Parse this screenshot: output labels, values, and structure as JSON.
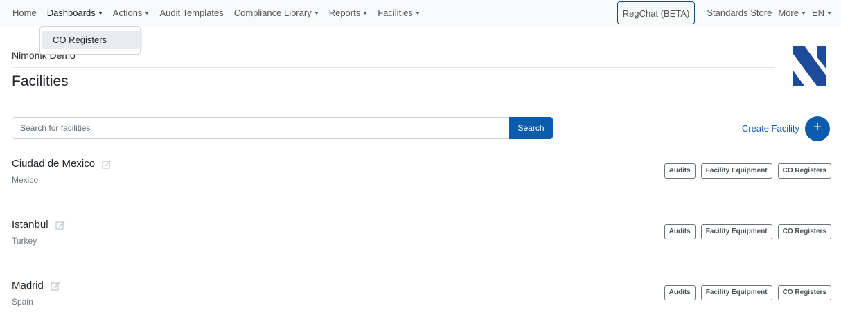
{
  "nav": {
    "home": "Home",
    "dashboards": "Dashboards",
    "actions": "Actions",
    "audit_templates": "Audit Templates",
    "compliance_library": "Compliance Library",
    "reports": "Reports",
    "facilities": "Facilities",
    "regchat": "RegChat (BETA)",
    "standards_store": "Standards Store",
    "more": "More",
    "language": "EN"
  },
  "dropdown": {
    "items": [
      "CO Registers"
    ]
  },
  "header": {
    "org_name": "Nimonik Demo",
    "title": "Facilities"
  },
  "search": {
    "placeholder": "Search for facilities",
    "button": "Search"
  },
  "create": {
    "label": "Create Facility",
    "icon": "+"
  },
  "facilities": [
    {
      "name": "Ciudad de Mexico",
      "country": "Mexico"
    },
    {
      "name": "Istanbul",
      "country": "Turkey"
    },
    {
      "name": "Madrid",
      "country": "Spain"
    }
  ],
  "facility_actions": {
    "audits": "Audits",
    "equipment": "Facility Equipment",
    "co_registers": "CO Registers"
  },
  "colors": {
    "primary": "#0b5cad",
    "logo": "#1e4a9c"
  }
}
